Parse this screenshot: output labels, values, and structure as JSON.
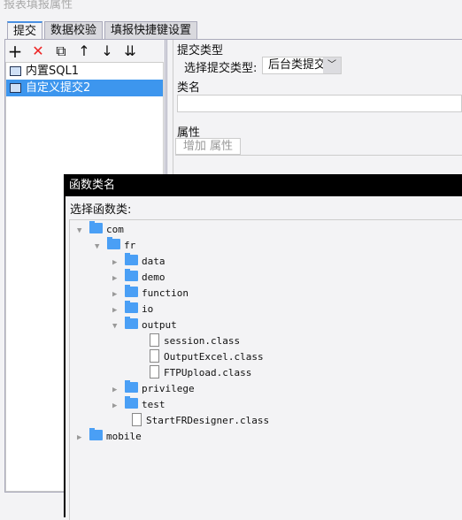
{
  "window": {
    "title": "报表填报属性"
  },
  "tabs": [
    "提交",
    "数据校验",
    "填报快捷键设置"
  ],
  "toolbar": {
    "add": "+",
    "delete": "✕",
    "copy": "⧉",
    "up": "↑",
    "down": "↓",
    "bottom": "⇊"
  },
  "list": [
    "内置SQL1",
    "自定义提交2"
  ],
  "submit_type": {
    "group": "提交类型",
    "label": "选择提交类型:",
    "value": "后台类提交"
  },
  "class_name": {
    "group": "类名",
    "value": ""
  },
  "properties": {
    "group": "属性",
    "add_label": "增加 属性"
  },
  "dialog": {
    "title": "函数类名",
    "label": "选择函数类:",
    "tree": [
      {
        "label": "com",
        "type": "folder",
        "level": 0,
        "expanded": true
      },
      {
        "label": "fr",
        "type": "folder",
        "level": 1,
        "expanded": true
      },
      {
        "label": "data",
        "type": "folder",
        "level": 2,
        "expanded": false
      },
      {
        "label": "demo",
        "type": "folder",
        "level": 2,
        "expanded": false
      },
      {
        "label": "function",
        "type": "folder",
        "level": 2,
        "expanded": false
      },
      {
        "label": "io",
        "type": "folder",
        "level": 2,
        "expanded": false
      },
      {
        "label": "output",
        "type": "folder",
        "level": 2,
        "expanded": true
      },
      {
        "label": "session.class",
        "type": "file",
        "level": 3
      },
      {
        "label": "OutputExcel.class",
        "type": "file",
        "level": 3
      },
      {
        "label": "FTPUpload.class",
        "type": "file",
        "level": 3
      },
      {
        "label": "privilege",
        "type": "folder",
        "level": 2,
        "expanded": false
      },
      {
        "label": "test",
        "type": "folder",
        "level": 2,
        "expanded": false
      },
      {
        "label": "StartFRDesigner.class",
        "type": "file",
        "level": 2
      },
      {
        "label": "mobile",
        "type": "folder",
        "level": 0,
        "expanded": false
      }
    ]
  },
  "colors": {
    "selection": "#3d96ee",
    "folder": "#4a9ff5",
    "dialog_title_bg": "#000000"
  }
}
